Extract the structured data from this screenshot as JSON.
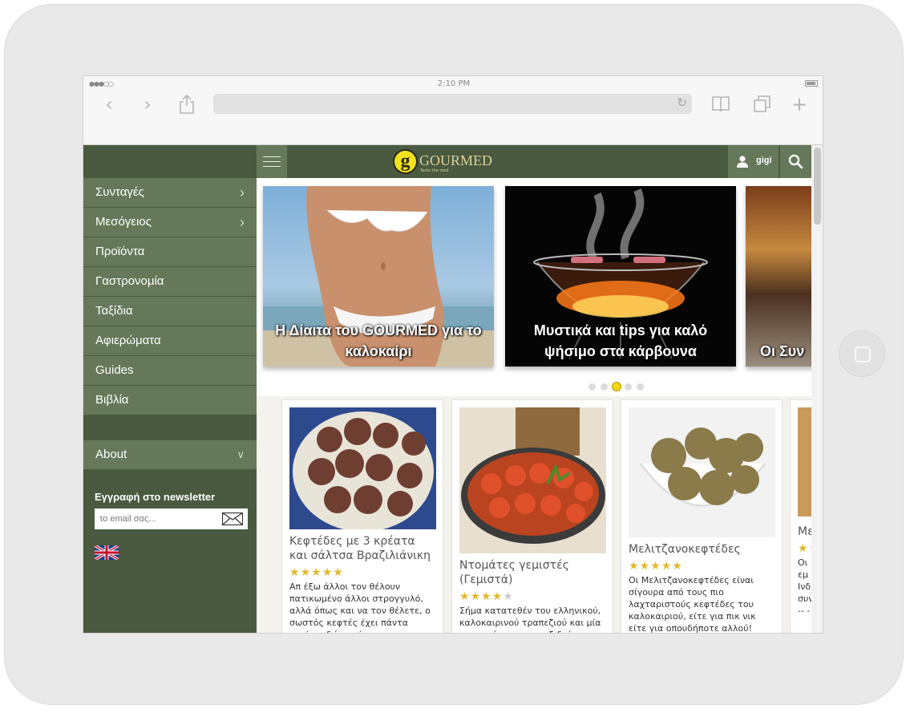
{
  "browser": {
    "time": "2:10 PM",
    "signal": "●●●○○"
  },
  "site": {
    "logo_text": "GOURMED",
    "logo_letter": "g",
    "logo_tagline": "Taste the med",
    "user_name": "gigi"
  },
  "sidebar": {
    "items": [
      {
        "label": "Συνταγές",
        "has_chevron": true
      },
      {
        "label": "Μεσόγειος",
        "has_chevron": true
      },
      {
        "label": "Προϊόντα",
        "has_chevron": false
      },
      {
        "label": "Γαστρονομία",
        "has_chevron": false
      },
      {
        "label": "Ταξίδια",
        "has_chevron": false
      },
      {
        "label": "Αφιερώματα",
        "has_chevron": false
      },
      {
        "label": "Guides",
        "has_chevron": false
      },
      {
        "label": "Βιβλία",
        "has_chevron": false
      }
    ],
    "about_label": "About",
    "newsletter_title": "Εγγραφή στο newsletter",
    "newsletter_placeholder": "το email σας..."
  },
  "slider": {
    "slides": [
      {
        "title": "Η Δίαιτα του GOURMED για το καλοκαίρι"
      },
      {
        "title": "Μυστικά και tips για καλό ψήσιμο στα κάρβουνα"
      },
      {
        "title": "Οι Συν"
      }
    ],
    "dot_count": 5,
    "active_dot": 2
  },
  "recipes": [
    {
      "title": "Κεφτέδες με 3 κρέατα και σάλτσα Βραζιλιάνικη",
      "rating": 5,
      "text": "Απ έξω άλλοι τον θέλουν πατικωμένο άλλοι στρογγυλό, αλλά όπως και να τον θέλετε, ο σωστός κεφτές έχει πάντα τριών ειδών κρέατα"
    },
    {
      "title": "Ντομάτες γεμιστές (Γεμιστά)",
      "rating": 4,
      "text": "Σήμα κατατεθέν του ελληνικού, καλοκαιρινού τραπεζιού και μία συνταγή που μας ταξιδεύει"
    },
    {
      "title": "Μελιτζανοκεφτέδες",
      "rating": 5,
      "text": "Οι Μελιτζανοκεφτέδες είναι σίγουρα από τους πιο λαχταριστούς κεφτέδες του καλοκαιριού, είτε για πικ νικ είτε για οπουδήποτε αλλού!"
    },
    {
      "title": "Με",
      "rating": 1,
      "text": "Οι εμ Ινδ συν -- -"
    }
  ],
  "colors": {
    "sidebar_dark": "#4a5a40",
    "sidebar_item": "#66785a",
    "star": "#e0b92c",
    "active_dot": "#f0d81a"
  }
}
